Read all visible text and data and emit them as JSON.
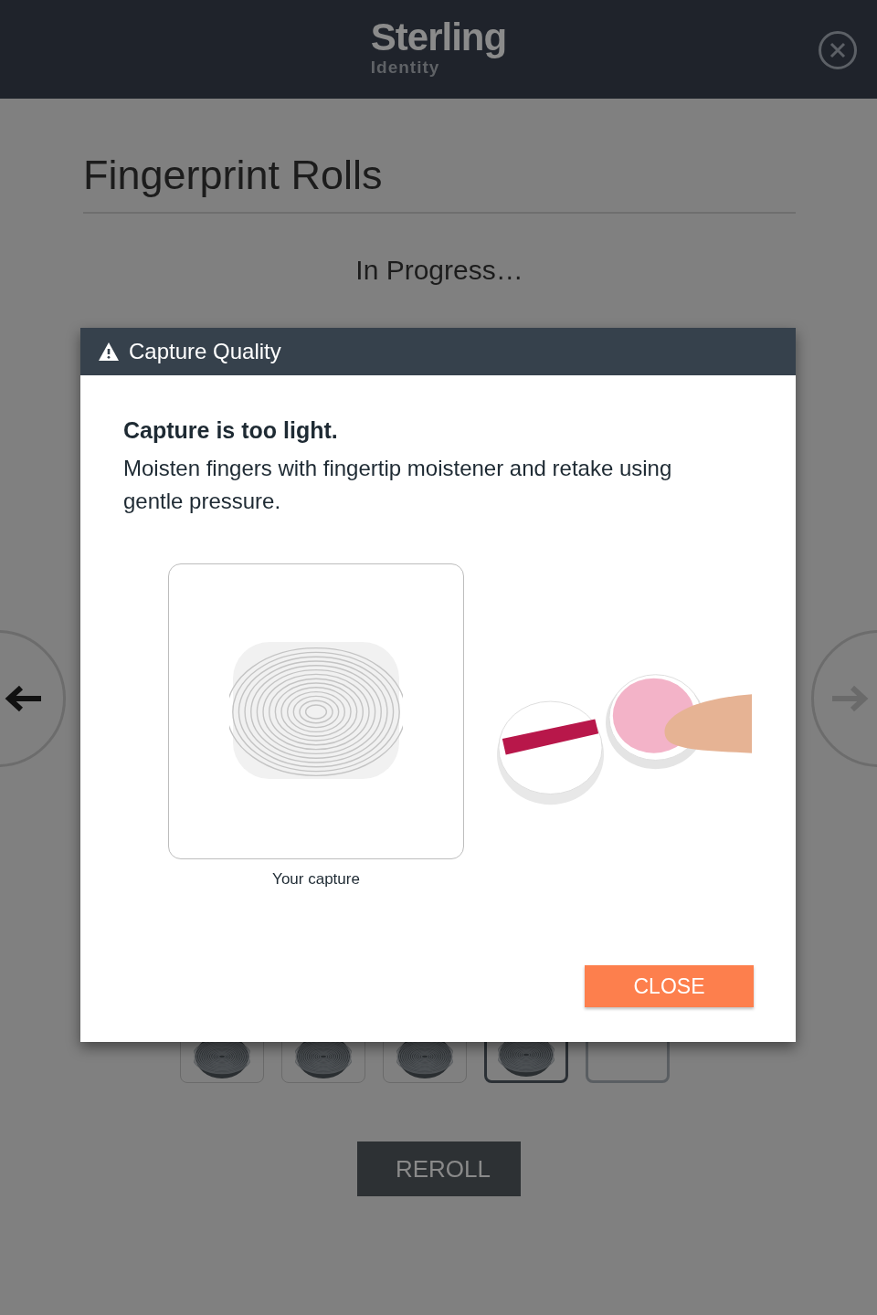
{
  "header": {
    "brand": "Sterling",
    "subbrand": "Identity"
  },
  "page": {
    "title": "Fingerprint Rolls",
    "status": "In Progress…"
  },
  "navigation": {
    "previous": {
      "disabled": false
    },
    "next": {
      "disabled": true
    }
  },
  "thumbnails": [
    {
      "captured": true,
      "selected": false
    },
    {
      "captured": true,
      "selected": false
    },
    {
      "captured": true,
      "selected": false
    },
    {
      "captured": true,
      "selected": true
    },
    {
      "captured": false,
      "selected": false
    }
  ],
  "reroll_button": "REROLL",
  "dialog": {
    "title": "Capture Quality",
    "heading": "Capture is too light.",
    "message": "Moisten fingers with fingertip moistener and retake using gentle pressure.",
    "capture_caption": "Your capture",
    "close_button": "CLOSE"
  }
}
